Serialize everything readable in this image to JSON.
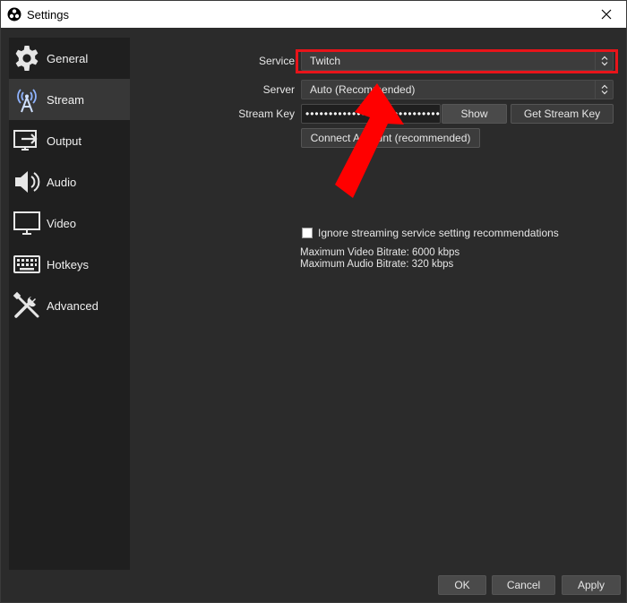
{
  "window": {
    "title": "Settings"
  },
  "sidebar": {
    "items": [
      {
        "label": "General",
        "icon": "gear-icon"
      },
      {
        "label": "Stream",
        "icon": "antenna-icon"
      },
      {
        "label": "Output",
        "icon": "output-icon"
      },
      {
        "label": "Audio",
        "icon": "speaker-icon"
      },
      {
        "label": "Video",
        "icon": "monitor-icon"
      },
      {
        "label": "Hotkeys",
        "icon": "keyboard-icon"
      },
      {
        "label": "Advanced",
        "icon": "tools-icon"
      }
    ],
    "active": "Stream"
  },
  "stream": {
    "service_label": "Service",
    "service_value": "Twitch",
    "server_label": "Server",
    "server_value": "Auto (Recommended)",
    "stream_key_label": "Stream Key",
    "stream_key_value": "••••••••••••••••••••••••••••••",
    "show_label": "Show",
    "get_key_label": "Get Stream Key",
    "connect_label": "Connect Account (recommended)",
    "ignore_label": "Ignore streaming service setting recommendations",
    "ignore_checked": false,
    "max_video": "Maximum Video Bitrate: 6000 kbps",
    "max_audio": "Maximum Audio Bitrate: 320 kbps"
  },
  "footer": {
    "ok": "OK",
    "cancel": "Cancel",
    "apply": "Apply"
  },
  "colors": {
    "highlight": "#e8141a",
    "arrow": "#ff0000"
  }
}
